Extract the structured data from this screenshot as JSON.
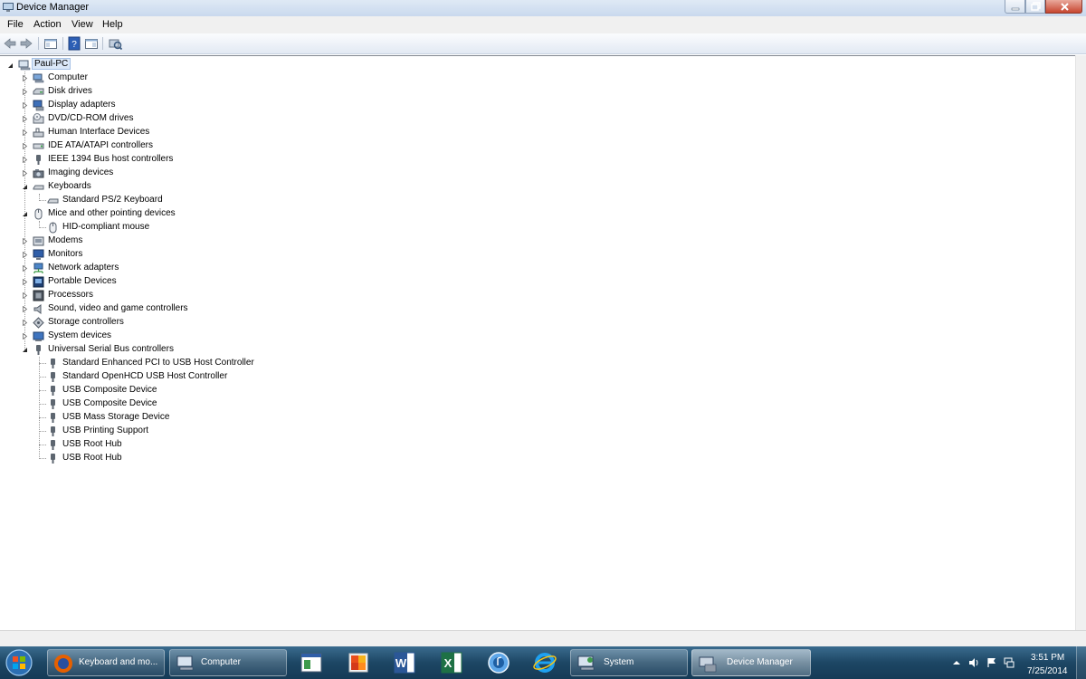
{
  "window": {
    "title": "Device Manager"
  },
  "menu": [
    "File",
    "Action",
    "View",
    "Help"
  ],
  "toolbar": {
    "icons": [
      "back-arrow-icon",
      "forward-arrow-icon",
      "show-hide-tree-icon",
      "help-icon",
      "properties-icon",
      "scan-hardware-icon"
    ]
  },
  "tree": {
    "root": "Paul-PC",
    "categories": [
      {
        "label": "Computer",
        "icon": "computer-icon",
        "expanded": false
      },
      {
        "label": "Disk drives",
        "icon": "disk-drive-icon",
        "expanded": false
      },
      {
        "label": "Display adapters",
        "icon": "display-adapter-icon",
        "expanded": false
      },
      {
        "label": "DVD/CD-ROM drives",
        "icon": "dvd-drive-icon",
        "expanded": false
      },
      {
        "label": "Human Interface Devices",
        "icon": "hid-icon",
        "expanded": false
      },
      {
        "label": "IDE ATA/ATAPI controllers",
        "icon": "ide-controller-icon",
        "expanded": false
      },
      {
        "label": "IEEE 1394 Bus host controllers",
        "icon": "ieee1394-icon",
        "expanded": false
      },
      {
        "label": "Imaging devices",
        "icon": "camera-icon",
        "expanded": false
      },
      {
        "label": "Keyboards",
        "icon": "keyboard-icon",
        "expanded": true,
        "children": [
          "Standard PS/2 Keyboard"
        ]
      },
      {
        "label": "Mice and other pointing devices",
        "icon": "mouse-icon",
        "expanded": true,
        "children": [
          "HID-compliant mouse"
        ]
      },
      {
        "label": "Modems",
        "icon": "modem-icon",
        "expanded": false
      },
      {
        "label": "Monitors",
        "icon": "monitor-icon",
        "expanded": false
      },
      {
        "label": "Network adapters",
        "icon": "network-adapter-icon",
        "expanded": false
      },
      {
        "label": "Portable Devices",
        "icon": "portable-device-icon",
        "expanded": false
      },
      {
        "label": "Processors",
        "icon": "processor-icon",
        "expanded": false
      },
      {
        "label": "Sound, video and game controllers",
        "icon": "speaker-icon",
        "expanded": false
      },
      {
        "label": "Storage controllers",
        "icon": "storage-controller-icon",
        "expanded": false
      },
      {
        "label": "System devices",
        "icon": "system-device-icon",
        "expanded": false
      },
      {
        "label": "Universal Serial Bus controllers",
        "icon": "usb-icon",
        "expanded": true,
        "children": [
          "Standard Enhanced PCI to USB Host Controller",
          "Standard OpenHCD USB Host Controller",
          "USB Composite Device",
          "USB Composite Device",
          "USB Mass Storage Device",
          "USB Printing Support",
          "USB Root Hub",
          "USB Root Hub"
        ]
      }
    ]
  },
  "taskbar": {
    "tasks": [
      {
        "label": "Keyboard and mo...",
        "icon": "firefox-icon"
      },
      {
        "label": "Computer",
        "icon": "computer-icon"
      },
      {
        "label": "System",
        "icon": "system-icon"
      },
      {
        "label": "Device Manager",
        "icon": "device-manager-icon"
      }
    ],
    "pinned": [
      "window-app-icon",
      "office-icon",
      "word-icon",
      "excel-icon",
      "itunes-icon",
      "internet-explorer-icon"
    ],
    "clock": {
      "time": "3:51 PM",
      "date": "7/25/2014"
    }
  },
  "colors": {
    "selection": "#dbe8f8",
    "taskbar": "#1d4664"
  }
}
